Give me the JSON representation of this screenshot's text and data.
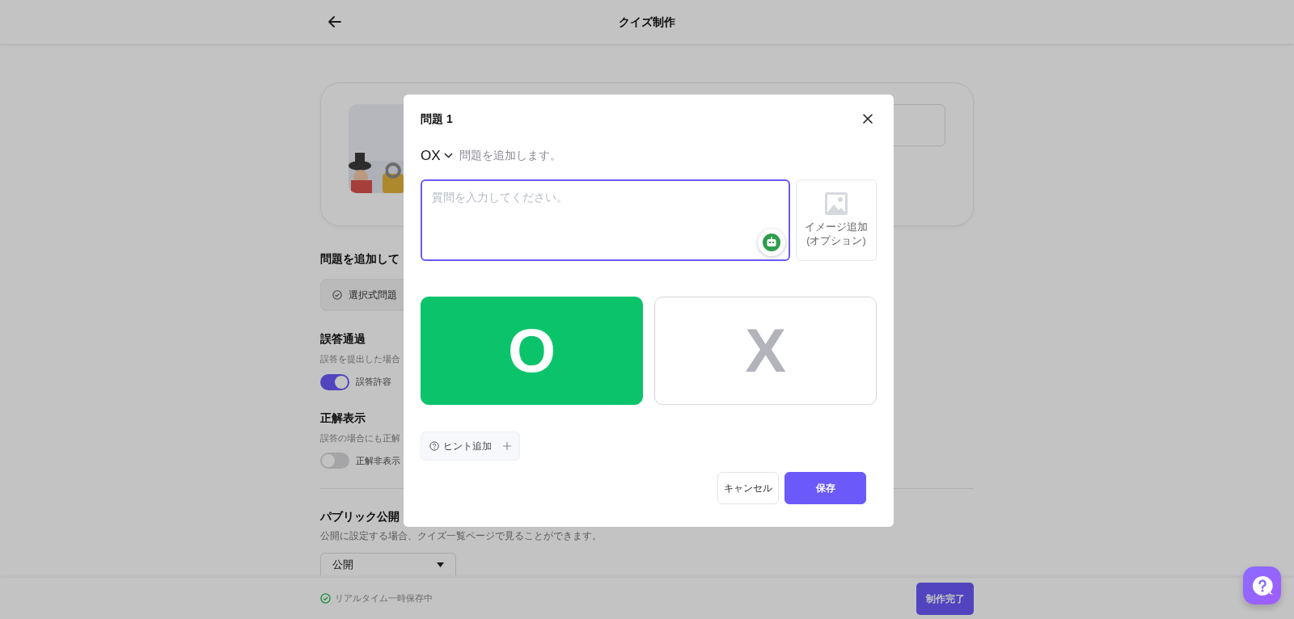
{
  "header": {
    "title": "クイズ制作"
  },
  "add_question": {
    "heading": "問題を追加して",
    "type_button": "選択式問題"
  },
  "settings": [
    {
      "title": "誤答通過",
      "description": "誤答を提出した場合",
      "toggle_label": "誤答許容",
      "on": true
    },
    {
      "title": "正解表示",
      "description": "誤答の場合にも正解",
      "toggle_label": "正解非表示",
      "on": false
    }
  ],
  "public": {
    "title": "パブリック公開",
    "description": "公開に設定する場合、クイズ一覧ページで見ることができます。",
    "select_value": "公開"
  },
  "footer": {
    "status": "リアルタイム一時保存中",
    "button": "制作完了"
  },
  "modal": {
    "title": "問題 1",
    "type": "OX",
    "type_hint": "問題を追加します。",
    "question": {
      "placeholder": "質問を入力してください。"
    },
    "image_add_label": "イメージ追加\n(オプション)",
    "answers": [
      {
        "label": "O",
        "selected": true
      },
      {
        "label": "X",
        "selected": false
      }
    ],
    "hint_button": "ヒント追加",
    "buttons": [
      {
        "label": "キャンセル",
        "kind": "secondary"
      },
      {
        "label": "保存",
        "kind": "primary"
      }
    ]
  }
}
